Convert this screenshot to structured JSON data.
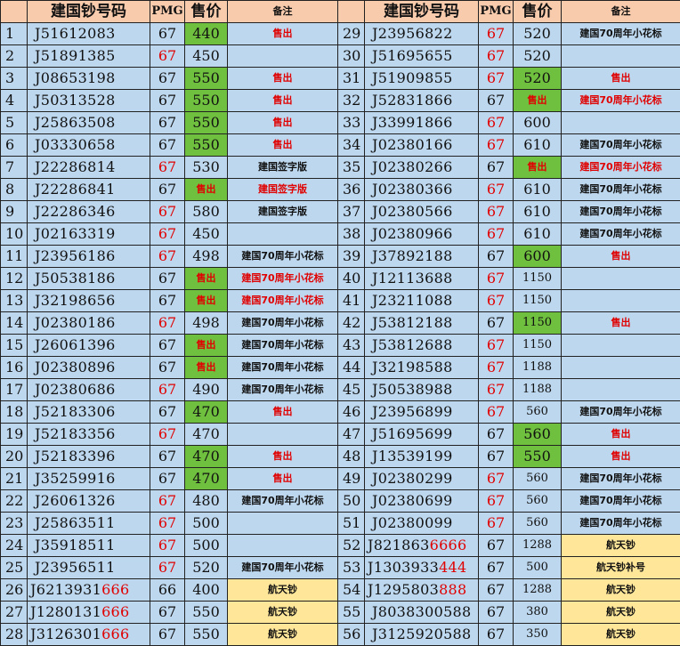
{
  "headers": {
    "serial": "建国钞号码",
    "grade": "PMG",
    "price": "售价",
    "note": "备注"
  },
  "rows": [
    [
      {
        "idx": "1",
        "serial": "J51612083",
        "grade": "67",
        "grade_red": false,
        "price": "440",
        "price_green": true,
        "price_sold": false,
        "note": "售出",
        "note_red": true,
        "note_gold": false
      },
      {
        "idx": "29",
        "serial": "J23956822",
        "grade": "67",
        "grade_red": true,
        "price": "520",
        "price_green": false,
        "price_sold": false,
        "note": "建国70周年小花标",
        "note_red": false,
        "note_gold": false
      }
    ],
    [
      {
        "idx": "2",
        "serial": "J51891385",
        "grade": "67",
        "grade_red": true,
        "price": "450",
        "price_green": false,
        "price_sold": false,
        "note": "",
        "note_red": false,
        "note_gold": false
      },
      {
        "idx": "30",
        "serial": "J51695655",
        "grade": "67",
        "grade_red": true,
        "price": "520",
        "price_green": false,
        "price_sold": false,
        "note": "",
        "note_red": false,
        "note_gold": false
      }
    ],
    [
      {
        "idx": "3",
        "serial": "J08653198",
        "grade": "67",
        "grade_red": false,
        "price": "550",
        "price_green": true,
        "price_sold": false,
        "note": "售出",
        "note_red": true,
        "note_gold": false
      },
      {
        "idx": "31",
        "serial": "J51909855",
        "grade": "67",
        "grade_red": true,
        "price": "520",
        "price_green": true,
        "price_sold": false,
        "note": "售出",
        "note_red": true,
        "note_gold": false
      }
    ],
    [
      {
        "idx": "4",
        "serial": "J50313528",
        "grade": "67",
        "grade_red": false,
        "price": "550",
        "price_green": true,
        "price_sold": false,
        "note": "售出",
        "note_red": true,
        "note_gold": false
      },
      {
        "idx": "32",
        "serial": "J52831866",
        "grade": "67",
        "grade_red": false,
        "price": "售出",
        "price_green": true,
        "price_sold": true,
        "note": "建国70周年小花标",
        "note_red": true,
        "note_gold": false
      }
    ],
    [
      {
        "idx": "5",
        "serial": "J25863508",
        "grade": "67",
        "grade_red": false,
        "price": "550",
        "price_green": true,
        "price_sold": false,
        "note": "售出",
        "note_red": true,
        "note_gold": false
      },
      {
        "idx": "33",
        "serial": "J33991866",
        "grade": "67",
        "grade_red": true,
        "price": "600",
        "price_green": false,
        "price_sold": false,
        "note": "",
        "note_red": false,
        "note_gold": false
      }
    ],
    [
      {
        "idx": "6",
        "serial": "J03330658",
        "grade": "67",
        "grade_red": false,
        "price": "550",
        "price_green": true,
        "price_sold": false,
        "note": "售出",
        "note_red": true,
        "note_gold": false
      },
      {
        "idx": "34",
        "serial": "J02380166",
        "grade": "67",
        "grade_red": true,
        "price": "610",
        "price_green": false,
        "price_sold": false,
        "note": "建国70周年小花标",
        "note_red": false,
        "note_gold": false
      }
    ],
    [
      {
        "idx": "7",
        "serial": "J22286814",
        "grade": "67",
        "grade_red": true,
        "price": "530",
        "price_green": false,
        "price_sold": false,
        "note": "建国签字版",
        "note_red": false,
        "note_gold": false
      },
      {
        "idx": "35",
        "serial": "J02380266",
        "grade": "67",
        "grade_red": false,
        "price": "售出",
        "price_green": true,
        "price_sold": true,
        "note": "建国70周年小花标",
        "note_red": true,
        "note_gold": false
      }
    ],
    [
      {
        "idx": "8",
        "serial": "J22286841",
        "grade": "67",
        "grade_red": false,
        "price": "售出",
        "price_green": true,
        "price_sold": true,
        "note": "建国签字版",
        "note_red": true,
        "note_gold": false
      },
      {
        "idx": "36",
        "serial": "J02380366",
        "grade": "67",
        "grade_red": true,
        "price": "610",
        "price_green": false,
        "price_sold": false,
        "note": "建国70周年小花标",
        "note_red": false,
        "note_gold": false
      }
    ],
    [
      {
        "idx": "9",
        "serial": "J22286346",
        "grade": "67",
        "grade_red": true,
        "price": "580",
        "price_green": false,
        "price_sold": false,
        "note": "建国签字版",
        "note_red": false,
        "note_gold": false
      },
      {
        "idx": "37",
        "serial": "J02380566",
        "grade": "67",
        "grade_red": true,
        "price": "610",
        "price_green": false,
        "price_sold": false,
        "note": "建国70周年小花标",
        "note_red": false,
        "note_gold": false
      }
    ],
    [
      {
        "idx": "10",
        "serial": "J02163319",
        "grade": "67",
        "grade_red": true,
        "price": "450",
        "price_green": false,
        "price_sold": false,
        "note": "",
        "note_red": false,
        "note_gold": false
      },
      {
        "idx": "38",
        "serial": "J02380966",
        "grade": "67",
        "grade_red": true,
        "price": "610",
        "price_green": false,
        "price_sold": false,
        "note": "建国70周年小花标",
        "note_red": false,
        "note_gold": false
      }
    ],
    [
      {
        "idx": "11",
        "serial": "J23956186",
        "grade": "67",
        "grade_red": true,
        "price": "498",
        "price_green": false,
        "price_sold": false,
        "note": "建国70周年小花标",
        "note_red": false,
        "note_gold": false
      },
      {
        "idx": "39",
        "serial": "J37892188",
        "grade": "67",
        "grade_red": false,
        "price": "600",
        "price_green": true,
        "price_sold": false,
        "note": "售出",
        "note_red": true,
        "note_gold": false
      }
    ],
    [
      {
        "idx": "12",
        "serial": "J50538186",
        "grade": "67",
        "grade_red": false,
        "price": "售出",
        "price_green": true,
        "price_sold": true,
        "note": "建国70周年小花标",
        "note_red": true,
        "note_gold": false
      },
      {
        "idx": "40",
        "serial": "J12113688",
        "grade": "67",
        "grade_red": true,
        "price": "1150",
        "price_green": false,
        "price_sold": false,
        "note": "",
        "note_red": false,
        "note_gold": false
      }
    ],
    [
      {
        "idx": "13",
        "serial": "J32198656",
        "grade": "67",
        "grade_red": false,
        "price": "售出",
        "price_green": true,
        "price_sold": true,
        "note": "建国70周年小花标",
        "note_red": true,
        "note_gold": false
      },
      {
        "idx": "41",
        "serial": "J23211088",
        "grade": "67",
        "grade_red": true,
        "price": "1150",
        "price_green": false,
        "price_sold": false,
        "note": "",
        "note_red": false,
        "note_gold": false
      }
    ],
    [
      {
        "idx": "14",
        "serial": "J02380186",
        "grade": "67",
        "grade_red": true,
        "price": "498",
        "price_green": false,
        "price_sold": false,
        "note": "建国70周年小花标",
        "note_red": false,
        "note_gold": false
      },
      {
        "idx": "42",
        "serial": "J53812188",
        "grade": "67",
        "grade_red": false,
        "price": "1150",
        "price_green": true,
        "price_sold": false,
        "note": "售出",
        "note_red": true,
        "note_gold": false
      }
    ],
    [
      {
        "idx": "15",
        "serial": "J26061396",
        "grade": "67",
        "grade_red": false,
        "price": "售出",
        "price_green": true,
        "price_sold": true,
        "note": "建国70周年小花标",
        "note_red": false,
        "note_gold": false
      },
      {
        "idx": "43",
        "serial": "J53812688",
        "grade": "67",
        "grade_red": true,
        "price": "1150",
        "price_green": false,
        "price_sold": false,
        "note": "",
        "note_red": false,
        "note_gold": false
      }
    ],
    [
      {
        "idx": "16",
        "serial": "J02380896",
        "grade": "67",
        "grade_red": false,
        "price": "售出",
        "price_green": true,
        "price_sold": true,
        "note": "建国70周年小花标",
        "note_red": false,
        "note_gold": false
      },
      {
        "idx": "44",
        "serial": "J32198588",
        "grade": "67",
        "grade_red": true,
        "price": "1188",
        "price_green": false,
        "price_sold": false,
        "note": "",
        "note_red": false,
        "note_gold": false
      }
    ],
    [
      {
        "idx": "17",
        "serial": "J02380686",
        "grade": "67",
        "grade_red": true,
        "price": "490",
        "price_green": false,
        "price_sold": false,
        "note": "建国70周年小花标",
        "note_red": false,
        "note_gold": false
      },
      {
        "idx": "45",
        "serial": "J50538988",
        "grade": "67",
        "grade_red": true,
        "price": "1188",
        "price_green": false,
        "price_sold": false,
        "note": "",
        "note_red": false,
        "note_gold": false
      }
    ],
    [
      {
        "idx": "18",
        "serial": "J52183306",
        "grade": "67",
        "grade_red": false,
        "price": "470",
        "price_green": true,
        "price_sold": false,
        "note": "售出",
        "note_red": true,
        "note_gold": false
      },
      {
        "idx": "46",
        "serial": "J23956899",
        "grade": "67",
        "grade_red": true,
        "price": "560",
        "price_green": false,
        "price_sold": false,
        "note": "建国70周年小花标",
        "note_red": false,
        "note_gold": false
      }
    ],
    [
      {
        "idx": "19",
        "serial": "J52183356",
        "grade": "67",
        "grade_red": true,
        "price": "470",
        "price_green": false,
        "price_sold": false,
        "note": "",
        "note_red": false,
        "note_gold": false
      },
      {
        "idx": "47",
        "serial": "J51695699",
        "grade": "67",
        "grade_red": false,
        "price": "560",
        "price_green": true,
        "price_sold": false,
        "note": "售出",
        "note_red": true,
        "note_gold": false
      }
    ],
    [
      {
        "idx": "20",
        "serial": "J52183396",
        "grade": "67",
        "grade_red": false,
        "price": "470",
        "price_green": true,
        "price_sold": false,
        "note": "售出",
        "note_red": true,
        "note_gold": false
      },
      {
        "idx": "48",
        "serial": "J13539199",
        "grade": "67",
        "grade_red": false,
        "price": "550",
        "price_green": true,
        "price_sold": false,
        "note": "售出",
        "note_red": true,
        "note_gold": false
      }
    ],
    [
      {
        "idx": "21",
        "serial": "J35259916",
        "grade": "67",
        "grade_red": false,
        "price": "470",
        "price_green": true,
        "price_sold": false,
        "note": "售出",
        "note_red": true,
        "note_gold": false
      },
      {
        "idx": "49",
        "serial": "J02380299",
        "grade": "67",
        "grade_red": true,
        "price": "560",
        "price_green": false,
        "price_sold": false,
        "note": "建国70周年小花标",
        "note_red": false,
        "note_gold": false
      }
    ],
    [
      {
        "idx": "22",
        "serial": "J26061326",
        "grade": "67",
        "grade_red": true,
        "price": "480",
        "price_green": false,
        "price_sold": false,
        "note": "建国70周年小花标",
        "note_red": false,
        "note_gold": false
      },
      {
        "idx": "50",
        "serial": "J02380699",
        "grade": "67",
        "grade_red": true,
        "price": "560",
        "price_green": false,
        "price_sold": false,
        "note": "建国70周年小花标",
        "note_red": false,
        "note_gold": false
      }
    ],
    [
      {
        "idx": "23",
        "serial": "J25863511",
        "grade": "67",
        "grade_red": true,
        "price": "500",
        "price_green": false,
        "price_sold": false,
        "note": "",
        "note_red": false,
        "note_gold": false
      },
      {
        "idx": "51",
        "serial": "J02380099",
        "grade": "67",
        "grade_red": true,
        "price": "560",
        "price_green": false,
        "price_sold": false,
        "note": "建国70周年小花标",
        "note_red": false,
        "note_gold": false
      }
    ],
    [
      {
        "idx": "24",
        "serial": "J35918511",
        "grade": "67",
        "grade_red": true,
        "price": "500",
        "price_green": false,
        "price_sold": false,
        "note": "",
        "note_red": false,
        "note_gold": false
      },
      {
        "idx": "52",
        "serial": "J821863",
        "serial_tail": "6666",
        "grade": "67",
        "grade_red": false,
        "price": "1288",
        "price_green": false,
        "price_sold": false,
        "note": "航天钞",
        "note_red": false,
        "note_gold": true
      }
    ],
    [
      {
        "idx": "25",
        "serial": "J23956511",
        "grade": "67",
        "grade_red": true,
        "price": "520",
        "price_green": false,
        "price_sold": false,
        "note": "建国70周年小花标",
        "note_red": false,
        "note_gold": false
      },
      {
        "idx": "53",
        "serial": "J1303933",
        "serial_tail": "444",
        "grade": "67",
        "grade_red": false,
        "price": "500",
        "price_green": false,
        "price_sold": false,
        "note": "航天钞补号",
        "note_red": false,
        "note_gold": true
      }
    ],
    [
      {
        "idx": "26",
        "serial": "J6213931",
        "serial_tail": "666",
        "grade": "66",
        "grade_red": false,
        "price": "400",
        "price_green": false,
        "price_sold": false,
        "note": "航天钞",
        "note_red": false,
        "note_gold": true
      },
      {
        "idx": "54",
        "serial": "J1295803",
        "serial_tail": "888",
        "grade": "67",
        "grade_red": false,
        "price": "1288",
        "price_green": false,
        "price_sold": false,
        "note": "航天钞",
        "note_red": false,
        "note_gold": true
      }
    ],
    [
      {
        "idx": "27",
        "serial": "J1280131",
        "serial_tail": "666",
        "grade": "67",
        "grade_red": false,
        "price": "550",
        "price_green": false,
        "price_sold": false,
        "note": "航天钞",
        "note_red": false,
        "note_gold": true
      },
      {
        "idx": "55",
        "serial": "J8038300588",
        "grade": "67",
        "grade_red": false,
        "price": "380",
        "price_green": false,
        "price_sold": false,
        "note": "航天钞",
        "note_red": false,
        "note_gold": true
      }
    ],
    [
      {
        "idx": "28",
        "serial": "J3126301",
        "serial_tail": "666",
        "grade": "67",
        "grade_red": false,
        "price": "550",
        "price_green": false,
        "price_sold": false,
        "note": "航天钞",
        "note_red": false,
        "note_gold": true
      },
      {
        "idx": "56",
        "serial": "J3125920588",
        "grade": "67",
        "grade_red": false,
        "price": "350",
        "price_green": false,
        "price_sold": false,
        "note": "航天钞",
        "note_red": false,
        "note_gold": true
      }
    ]
  ]
}
